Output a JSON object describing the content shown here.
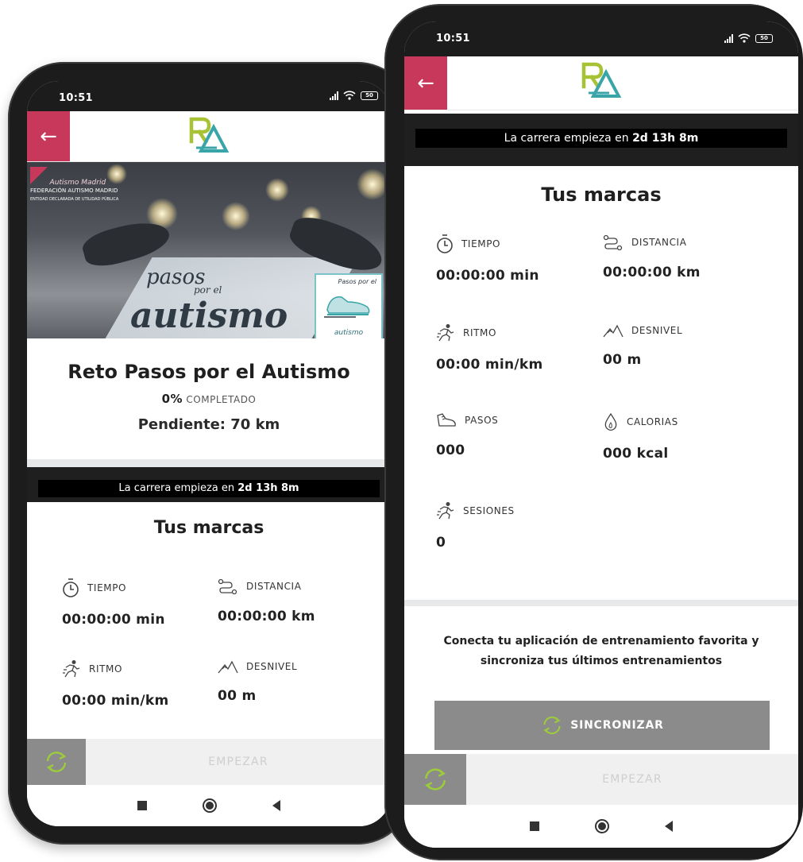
{
  "status_bar": {
    "time": "10:51",
    "battery": "50"
  },
  "app": {
    "back_label": "←",
    "logo_text": "RA",
    "colors": {
      "accent": "#c8385a",
      "logo_green": "#a7c335",
      "logo_teal": "#3aa5a8",
      "sync_green": "#9ccb3b"
    }
  },
  "hero": {
    "org_line": "FEDERACIÓN AUTISMO MADRID",
    "org_sub": "ENTIDAD DECLARADA DE UTILIDAD PÚBLICA",
    "org_script": "Autismo Madrid",
    "script_line1": "pasos",
    "script_small": "por el",
    "script_line2": "autismo",
    "badge_top": "Pasos por el",
    "badge_bottom": "autismo"
  },
  "challenge": {
    "title": "Reto Pasos por el Autismo",
    "percent": "0%",
    "percent_label": "COMPLETADO",
    "pending": "Pendiente: 70 km"
  },
  "countdown": {
    "prefix": "La carrera empieza en ",
    "time": "2d 13h 8m"
  },
  "marks": {
    "title": "Tus marcas",
    "tiempo_label": "TIEMPO",
    "tiempo_value": "00:00:00 min",
    "distancia_label": "DISTANCIA",
    "distancia_value": "00:00:00 km",
    "ritmo_label": "RITMO",
    "ritmo_value": "00:00 min/km",
    "desnivel_label": "DESNIVEL",
    "desnivel_value": "00 m",
    "pasos_label": "PASOS",
    "pasos_value": "000",
    "calorias_label": "CALORIAS",
    "calorias_value": "000 kcal",
    "sesiones_label": "SESIONES",
    "sesiones_value": "0"
  },
  "sync": {
    "message": "Conecta tu aplicación de entrenamiento favorita y sincroniza tus últimos entrenamientos",
    "button_label": "SINCRONIZAR"
  },
  "bottom": {
    "start_label": "EMPEZAR"
  }
}
